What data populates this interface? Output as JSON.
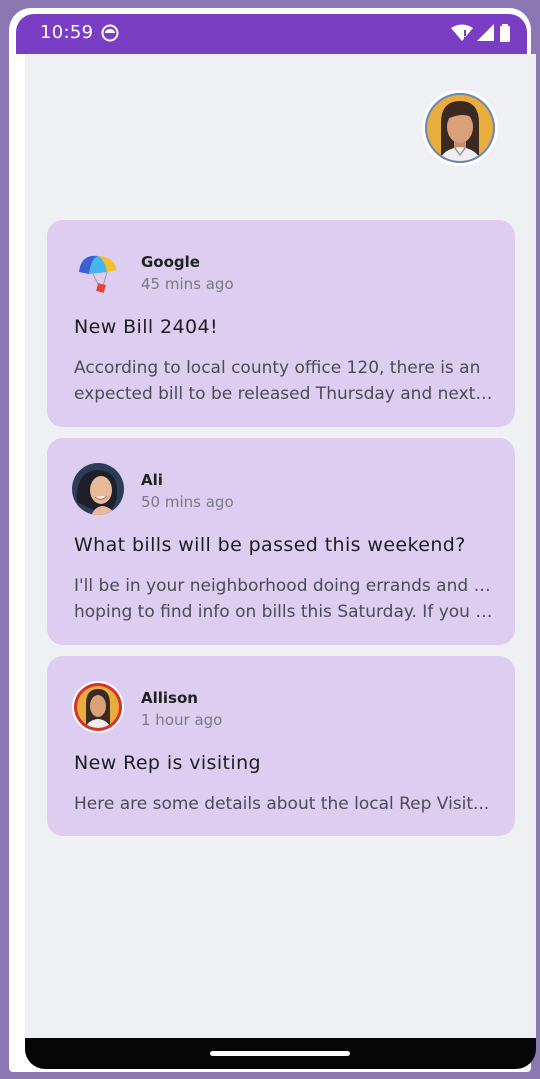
{
  "status_bar": {
    "time": "10:59"
  },
  "emails": [
    {
      "sender": "Google",
      "time_ago": "45 mins ago",
      "subject": "New Bill 2404!",
      "preview_line1": "According to local county office 120, there is an",
      "preview_line2": "expected bill to be released Thursday and next Tu..."
    },
    {
      "sender": "Ali",
      "time_ago": "50 mins ago",
      "subject": "What bills will be passed this weekend?",
      "preview_line1": "I'll be in your neighborhood doing errands and was",
      "preview_line2": "hoping to find info on bills this Saturday. If you do..."
    },
    {
      "sender": "Allison",
      "time_ago": "1 hour ago",
      "subject": "New Rep is visiting",
      "preview_line1": "Here are some details about the local Rep Visit...",
      "preview_line2": ""
    }
  ],
  "colors": {
    "status_bar": "#7a3ec4",
    "card_background": "#dccdf1",
    "screen_background": "#eef0f3"
  }
}
